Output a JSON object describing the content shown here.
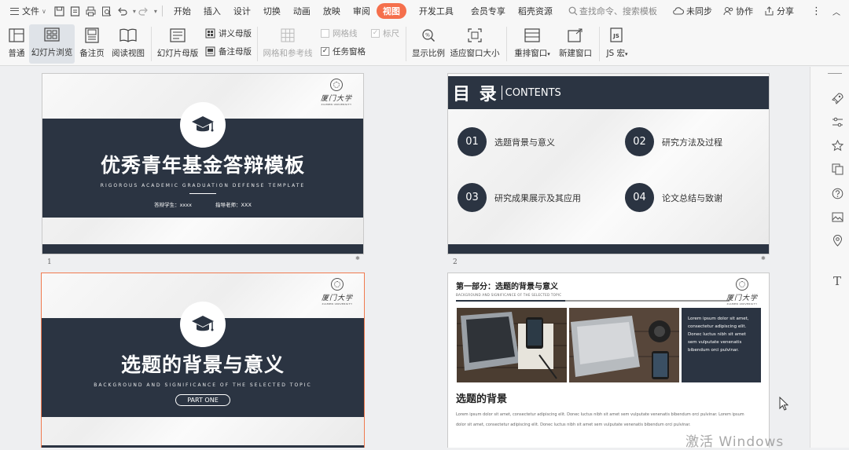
{
  "menubar": {
    "file_label": "文件",
    "tabs": [
      "开始",
      "插入",
      "设计",
      "切换",
      "动画",
      "放映",
      "审阅",
      "视图",
      "开发工具",
      "会员专享",
      "稻壳资源"
    ],
    "active_tab": "视图",
    "search_text": "查找命令、搜索模板",
    "sync_label": "未同步",
    "collab_label": "协作",
    "share_label": "分享"
  },
  "ribbon": {
    "normal": "普通",
    "slide_sorter": "幻灯片浏览",
    "notes_page": "备注页",
    "reading_view": "阅读视图",
    "slide_master": "幻灯片母版",
    "handout_master": "讲义母版",
    "notes_master": "备注母版",
    "grid_guides": "网格和参考线",
    "gridlines": "网格线",
    "ruler": "标尺",
    "task_pane": "任务窗格",
    "zoom": "显示比例",
    "fit_window": "适应窗口大小",
    "arrange_window": "重排窗口",
    "new_window": "新建窗口",
    "js_macro": "JS 宏"
  },
  "slides": {
    "s1": {
      "number": "1",
      "logo_cn": "厦门大学",
      "logo_en": "XIAMEN UNIVERSITY",
      "title": "优秀青年基金答辩模板",
      "subtitle": "RIGOROUS ACADEMIC GRADUATION DEFENSE TEMPLATE",
      "student": "答辩学生：xxxx",
      "advisor": "指导老师：XXX"
    },
    "s2": {
      "number": "2",
      "head_cn": "目 录",
      "head_en": "CONTENTS",
      "items": [
        {
          "num": "01",
          "label": "选题背景与意义"
        },
        {
          "num": "02",
          "label": "研究方法及过程"
        },
        {
          "num": "03",
          "label": "研究成果展示及其应用"
        },
        {
          "num": "04",
          "label": "论文总结与致谢"
        }
      ]
    },
    "s3": {
      "logo_cn": "厦门大学",
      "logo_en": "XIAMEN UNIVERSITY",
      "title": "选题的背景与意义",
      "subtitle": "BACKGROUND AND SIGNIFICANCE OF THE SELECTED TOPIC",
      "pill": "PART ONE"
    },
    "s4": {
      "head": "第一部分：选题的背景与意义",
      "head_sub": "BACKGROUND AND SIGNIFICANCE OF THE SELECTED TOPIC",
      "logo_cn": "厦门大学",
      "logo_en": "XIAMEN UNIVERSITY",
      "box_text": "Lorem ipsum dolor sit amet, consectetur adipiscing elit. Donec luctus nibh sit amet sem vulputate venenatis bibendum orci pulvinar.",
      "h2": "选题的背景",
      "body": "Lorem ipsum dolor sit amet, consectetur adipiscing elit. Donec luctus nibh sit amet sem vulputate venenatis bibendum orci pulvinar. Lorem ipsum dolor sit amet, consectetur adipiscing elit. Donec luctus nibh sit amet sem vulputate venenatis bibendum orci pulvinar."
    }
  },
  "watermark": "激活 Windows",
  "colors": {
    "accent": "#f56f4c",
    "slide_dark": "#2b3442",
    "selection": "#f07a4f"
  }
}
